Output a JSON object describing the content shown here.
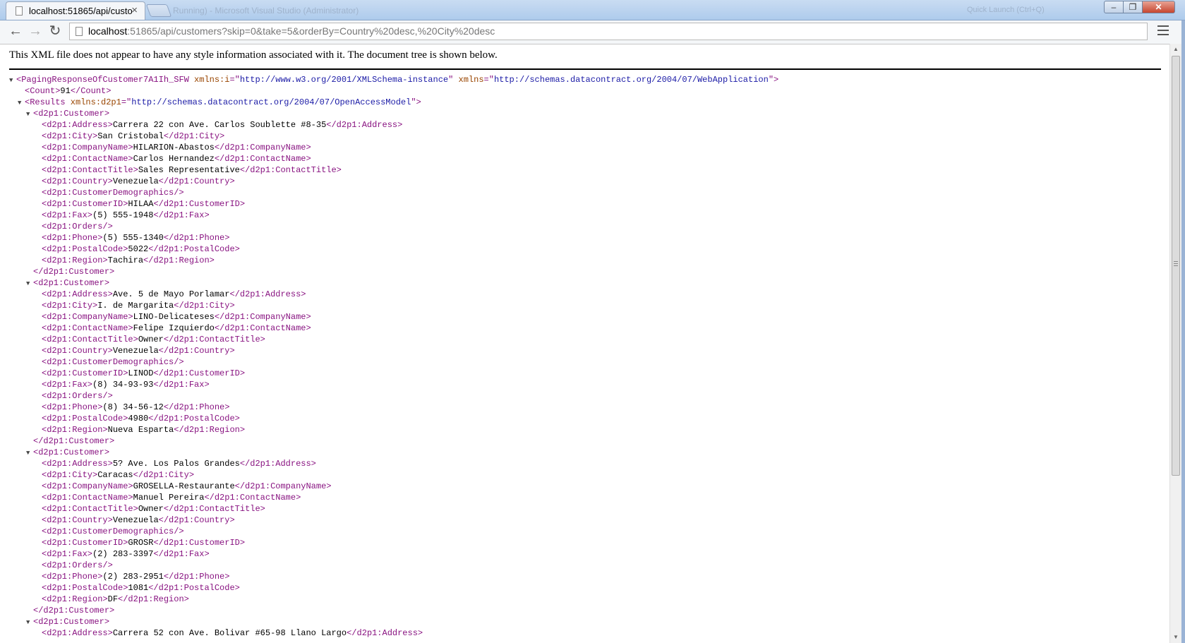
{
  "browser": {
    "tab_title": "localhost:51865/api/custo",
    "tab_close": "×",
    "background_window_title": "Running) - Microsoft Visual Studio (Administrator)",
    "background_search": "Quick Launch (Ctrl+Q)",
    "window_buttons": {
      "minimize": "–",
      "maximize": "❐",
      "close": "✕"
    },
    "nav": {
      "back": "←",
      "forward": "→",
      "reload": "↻"
    },
    "url_host": "localhost",
    "url_rest": ":51865/api/customers?skip=0&take=5&orderBy=Country%20desc,%20City%20desc",
    "bookmark_star": "☆"
  },
  "notice": "This XML file does not appear to have any style information associated with it. The document tree is shown below.",
  "xml_lines": [
    {
      "type": "open",
      "indent": 0,
      "toggle": true,
      "tag": "PagingResponseOfCustomer7A1Ih_SFW",
      "attrs": [
        {
          "name": "xmlns:i",
          "value": "http://www.w3.org/2001/XMLSchema-instance"
        },
        {
          "name": "xmlns",
          "value": "http://schemas.datacontract.org/2004/07/WebApplication"
        }
      ]
    },
    {
      "type": "elem",
      "indent": 1,
      "tag": "Count",
      "text": "91"
    },
    {
      "type": "open",
      "indent": 1,
      "toggle": true,
      "tag": "Results",
      "attrs": [
        {
          "name": "xmlns:d2p1",
          "value": "http://schemas.datacontract.org/2004/07/OpenAccessModel"
        }
      ]
    },
    {
      "type": "open",
      "indent": 2,
      "toggle": true,
      "tag": "d2p1:Customer",
      "attrs": []
    },
    {
      "type": "elem",
      "indent": 3,
      "tag": "d2p1:Address",
      "text": "Carrera 22 con Ave. Carlos Soublette #8-35"
    },
    {
      "type": "elem",
      "indent": 3,
      "tag": "d2p1:City",
      "text": "San Cristobal"
    },
    {
      "type": "elem",
      "indent": 3,
      "tag": "d2p1:CompanyName",
      "text": "HILARION-Abastos"
    },
    {
      "type": "elem",
      "indent": 3,
      "tag": "d2p1:ContactName",
      "text": "Carlos Hernandez"
    },
    {
      "type": "elem",
      "indent": 3,
      "tag": "d2p1:ContactTitle",
      "text": "Sales Representative"
    },
    {
      "type": "elem",
      "indent": 3,
      "tag": "d2p1:Country",
      "text": "Venezuela"
    },
    {
      "type": "self",
      "indent": 3,
      "tag": "d2p1:CustomerDemographics"
    },
    {
      "type": "elem",
      "indent": 3,
      "tag": "d2p1:CustomerID",
      "text": "HILAA"
    },
    {
      "type": "elem",
      "indent": 3,
      "tag": "d2p1:Fax",
      "text": "(5) 555-1948"
    },
    {
      "type": "self",
      "indent": 3,
      "tag": "d2p1:Orders"
    },
    {
      "type": "elem",
      "indent": 3,
      "tag": "d2p1:Phone",
      "text": "(5) 555-1340"
    },
    {
      "type": "elem",
      "indent": 3,
      "tag": "d2p1:PostalCode",
      "text": "5022"
    },
    {
      "type": "elem",
      "indent": 3,
      "tag": "d2p1:Region",
      "text": "Tachira"
    },
    {
      "type": "close",
      "indent": 2,
      "tag": "d2p1:Customer"
    },
    {
      "type": "open",
      "indent": 2,
      "toggle": true,
      "tag": "d2p1:Customer",
      "attrs": []
    },
    {
      "type": "elem",
      "indent": 3,
      "tag": "d2p1:Address",
      "text": "Ave. 5 de Mayo Porlamar"
    },
    {
      "type": "elem",
      "indent": 3,
      "tag": "d2p1:City",
      "text": "I. de Margarita"
    },
    {
      "type": "elem",
      "indent": 3,
      "tag": "d2p1:CompanyName",
      "text": "LINO-Delicateses"
    },
    {
      "type": "elem",
      "indent": 3,
      "tag": "d2p1:ContactName",
      "text": "Felipe Izquierdo"
    },
    {
      "type": "elem",
      "indent": 3,
      "tag": "d2p1:ContactTitle",
      "text": "Owner"
    },
    {
      "type": "elem",
      "indent": 3,
      "tag": "d2p1:Country",
      "text": "Venezuela"
    },
    {
      "type": "self",
      "indent": 3,
      "tag": "d2p1:CustomerDemographics"
    },
    {
      "type": "elem",
      "indent": 3,
      "tag": "d2p1:CustomerID",
      "text": "LINOD"
    },
    {
      "type": "elem",
      "indent": 3,
      "tag": "d2p1:Fax",
      "text": "(8) 34-93-93"
    },
    {
      "type": "self",
      "indent": 3,
      "tag": "d2p1:Orders"
    },
    {
      "type": "elem",
      "indent": 3,
      "tag": "d2p1:Phone",
      "text": "(8) 34-56-12"
    },
    {
      "type": "elem",
      "indent": 3,
      "tag": "d2p1:PostalCode",
      "text": "4980"
    },
    {
      "type": "elem",
      "indent": 3,
      "tag": "d2p1:Region",
      "text": "Nueva Esparta"
    },
    {
      "type": "close",
      "indent": 2,
      "tag": "d2p1:Customer"
    },
    {
      "type": "open",
      "indent": 2,
      "toggle": true,
      "tag": "d2p1:Customer",
      "attrs": []
    },
    {
      "type": "elem",
      "indent": 3,
      "tag": "d2p1:Address",
      "text": "5? Ave. Los Palos Grandes"
    },
    {
      "type": "elem",
      "indent": 3,
      "tag": "d2p1:City",
      "text": "Caracas"
    },
    {
      "type": "elem",
      "indent": 3,
      "tag": "d2p1:CompanyName",
      "text": "GROSELLA-Restaurante"
    },
    {
      "type": "elem",
      "indent": 3,
      "tag": "d2p1:ContactName",
      "text": "Manuel Pereira"
    },
    {
      "type": "elem",
      "indent": 3,
      "tag": "d2p1:ContactTitle",
      "text": "Owner"
    },
    {
      "type": "elem",
      "indent": 3,
      "tag": "d2p1:Country",
      "text": "Venezuela"
    },
    {
      "type": "self",
      "indent": 3,
      "tag": "d2p1:CustomerDemographics"
    },
    {
      "type": "elem",
      "indent": 3,
      "tag": "d2p1:CustomerID",
      "text": "GROSR"
    },
    {
      "type": "elem",
      "indent": 3,
      "tag": "d2p1:Fax",
      "text": "(2) 283-3397"
    },
    {
      "type": "self",
      "indent": 3,
      "tag": "d2p1:Orders"
    },
    {
      "type": "elem",
      "indent": 3,
      "tag": "d2p1:Phone",
      "text": "(2) 283-2951"
    },
    {
      "type": "elem",
      "indent": 3,
      "tag": "d2p1:PostalCode",
      "text": "1081"
    },
    {
      "type": "elem",
      "indent": 3,
      "tag": "d2p1:Region",
      "text": "DF"
    },
    {
      "type": "close",
      "indent": 2,
      "tag": "d2p1:Customer"
    },
    {
      "type": "open",
      "indent": 2,
      "toggle": true,
      "tag": "d2p1:Customer",
      "attrs": []
    },
    {
      "type": "elem",
      "indent": 3,
      "tag": "d2p1:Address",
      "text": "Carrera 52 con Ave. Bolivar #65-98 Llano Largo"
    }
  ]
}
